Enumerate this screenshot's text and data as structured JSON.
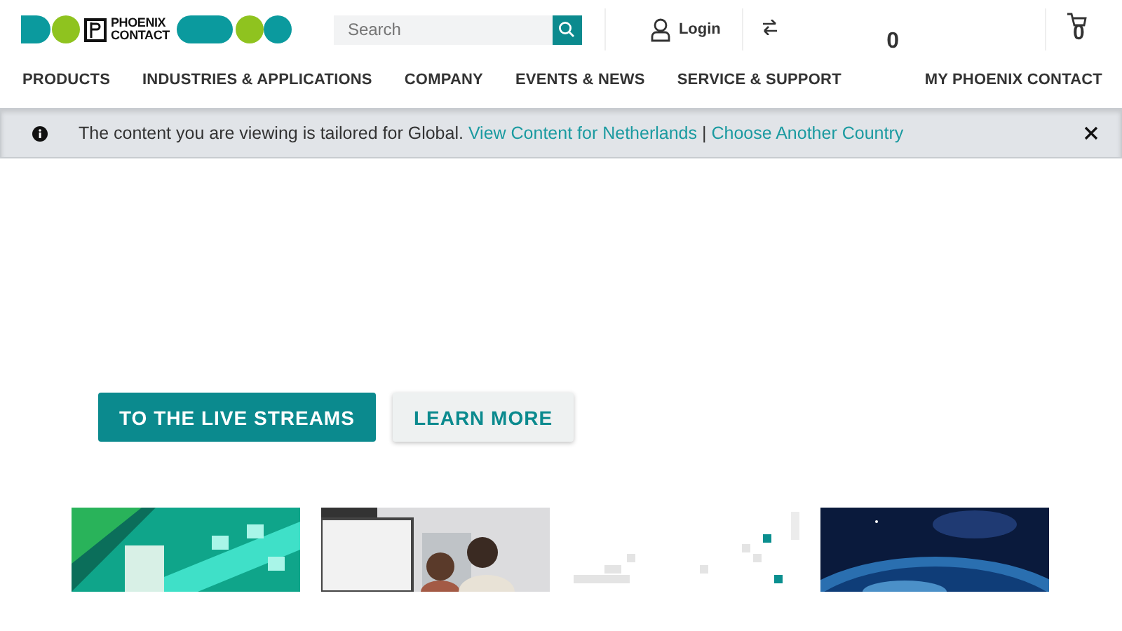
{
  "header": {
    "logo": {
      "line_1": "PHOENIX",
      "line_2": "CONTACT"
    },
    "search": {
      "placeholder": "Search"
    },
    "login": "Login",
    "compare_count": "0",
    "cart_count": "0"
  },
  "nav": {
    "items": [
      {
        "label": "PRODUCTS"
      },
      {
        "label": "INDUSTRIES & APPLICATIONS"
      },
      {
        "label": "COMPANY"
      },
      {
        "label": "EVENTS & NEWS"
      },
      {
        "label": "SERVICE & SUPPORT"
      }
    ],
    "account": "MY PHOENIX CONTACT"
  },
  "notice": {
    "text": "The content you are viewing is tailored for Global.",
    "link_1": "View Content for Netherlands",
    "separator": "|",
    "link_2": "Choose Another Country"
  },
  "hero": {
    "buttons": [
      {
        "label": "TO THE LIVE STREAMS",
        "kind": "primary"
      },
      {
        "label": "LEARN MORE",
        "kind": "secondary"
      }
    ]
  }
}
